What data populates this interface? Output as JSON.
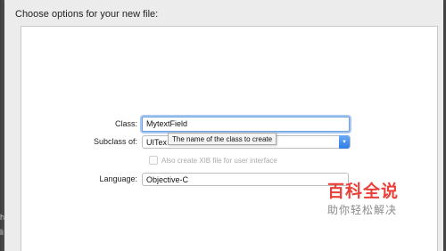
{
  "sheet": {
    "title": "Choose options for your new file:"
  },
  "form": {
    "class_label": "Class:",
    "class_value": "MytextField",
    "subclass_label": "Subclass of:",
    "subclass_value": "UITex",
    "tooltip": "The name of the class to create",
    "xib_checkbox_label": "Also create XIB file for user interface",
    "xib_checked": false,
    "language_label": "Language:",
    "language_value": "Objective-C"
  },
  "watermark": {
    "line1": "百科全说",
    "line2": "助你轻松解决"
  },
  "background": {
    "left_text_1": "h",
    "left_text_2": "li"
  }
}
